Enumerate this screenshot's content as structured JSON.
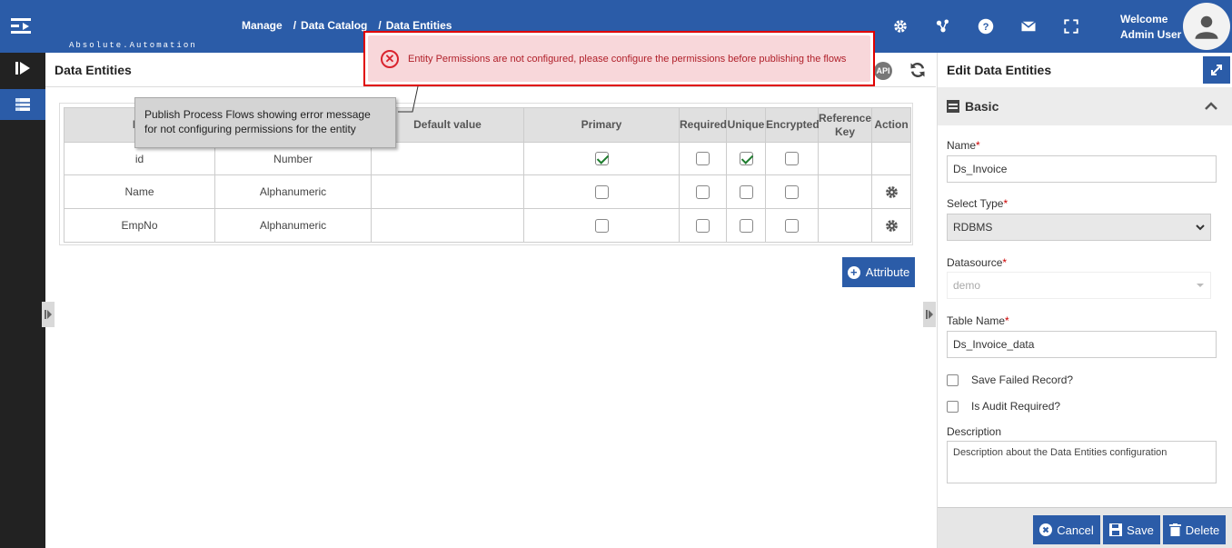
{
  "header": {
    "logo_tagline": "Absolute.Automation",
    "breadcrumb": [
      "Manage",
      "Data Catalog",
      "Data Entities"
    ],
    "welcome_line1": "Welcome",
    "welcome_line2": "Admin User",
    "icons": [
      "gear-icon",
      "nodes-icon",
      "help-icon",
      "mail-icon",
      "fullscreen-icon",
      "user-avatar-icon"
    ]
  },
  "main": {
    "title": "Data Entities",
    "api_label": "API",
    "table": {
      "headers": [
        "Na",
        "",
        "Default value",
        "Primary",
        "Required",
        "Unique",
        "Encrypted",
        "Reference Key",
        "Action"
      ],
      "rows": [
        {
          "name": "id",
          "type": "Number",
          "default": "",
          "primary": true,
          "required": false,
          "unique": true,
          "encrypted": false,
          "action": false
        },
        {
          "name": "Name",
          "type": "Alphanumeric",
          "default": "",
          "primary": false,
          "required": false,
          "unique": false,
          "encrypted": false,
          "action": true
        },
        {
          "name": "EmpNo",
          "type": "Alphanumeric",
          "default": "",
          "primary": false,
          "required": false,
          "unique": false,
          "encrypted": false,
          "action": true
        }
      ]
    },
    "attribute_button": "Attribute"
  },
  "panel": {
    "title": "Edit Data Entities",
    "section": "Basic",
    "name_label": "Name",
    "name_value": "Ds_Invoice",
    "type_label": "Select Type",
    "type_value": "RDBMS",
    "datasource_label": "Datasource",
    "datasource_value": "demo",
    "table_label": "Table Name",
    "table_value": "Ds_Invoice_data",
    "save_failed_label": "Save Failed Record?",
    "audit_label": "Is Audit Required?",
    "description_label": "Description",
    "description_value": "Description about the Data Entities configuration",
    "cancel": "Cancel",
    "save": "Save",
    "delete": "Delete"
  },
  "error": {
    "message": "Entity Permissions are not configured, please configure the permissions before publishing the flows"
  },
  "callout": {
    "line1": "Publish Process Flows showing error message",
    "line2": "for not configuring permissions for the entity"
  },
  "colors": {
    "brand": "#2b5ca8",
    "error": "#e00000",
    "error_bg": "#f8d7da",
    "rail": "#222222"
  }
}
